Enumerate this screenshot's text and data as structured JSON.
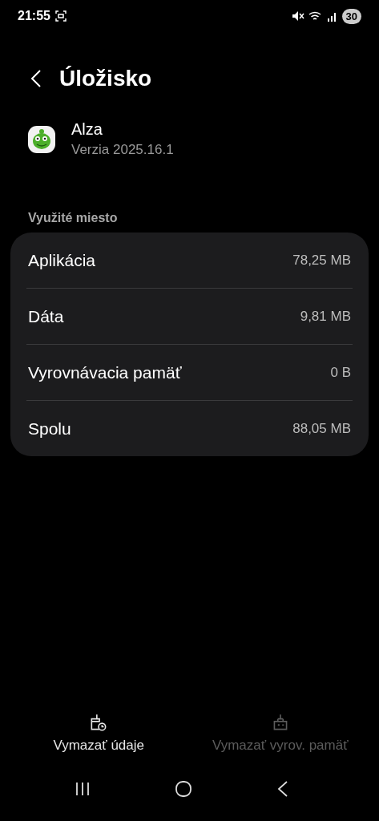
{
  "status_bar": {
    "time": "21:55",
    "battery": "30"
  },
  "header": {
    "title": "Úložisko"
  },
  "app": {
    "name": "Alza",
    "version": "Verzia 2025.16.1"
  },
  "section": {
    "label": "Využité miesto"
  },
  "rows": [
    {
      "label": "Aplikácia",
      "value": "78,25 MB"
    },
    {
      "label": "Dáta",
      "value": "9,81 MB"
    },
    {
      "label": "Vyrovnávacia pamäť",
      "value": "0 B"
    },
    {
      "label": "Spolu",
      "value": "88,05 MB"
    }
  ],
  "actions": [
    {
      "label": "Vymazať údaje",
      "kind": "clear-data",
      "disabled": false
    },
    {
      "label": "Vymazať vyrov. pamäť",
      "kind": "clear-cache",
      "disabled": true
    }
  ]
}
